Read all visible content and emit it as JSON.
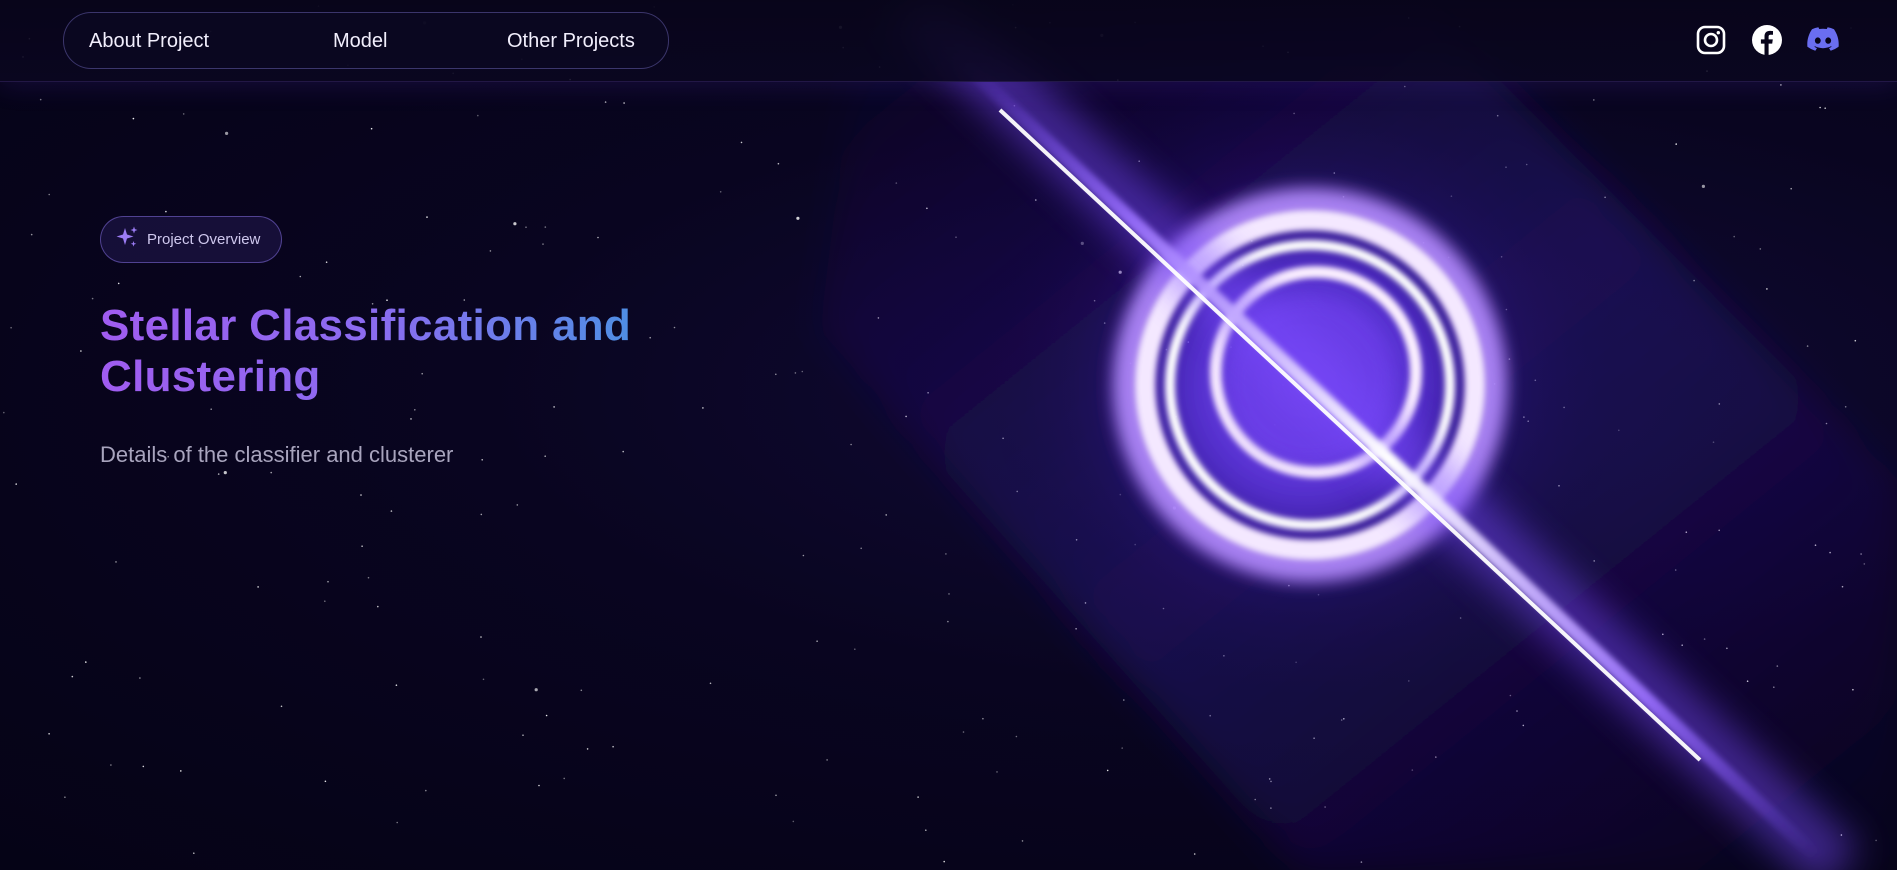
{
  "nav": {
    "items": [
      {
        "label": "About Project"
      },
      {
        "label": "Model"
      },
      {
        "label": "Other Projects"
      }
    ]
  },
  "socials": {
    "items": [
      {
        "icon": "instagram-icon",
        "color": "#ffffff"
      },
      {
        "icon": "facebook-icon",
        "color": "#ffffff"
      },
      {
        "icon": "discord-icon",
        "color": "#6a6ef0"
      }
    ]
  },
  "hero": {
    "badge": {
      "icon": "sparkles-icon",
      "label": "Project Overview"
    },
    "title_line1": "Stellar Classification and",
    "title_line2": "Clustering",
    "subtitle": "Details of the classifier and clusterer"
  },
  "colors": {
    "background": "#07041a",
    "accent_purple": "#a05cf0",
    "accent_blue": "#3a9ae0",
    "glow": "#7a4cff"
  }
}
